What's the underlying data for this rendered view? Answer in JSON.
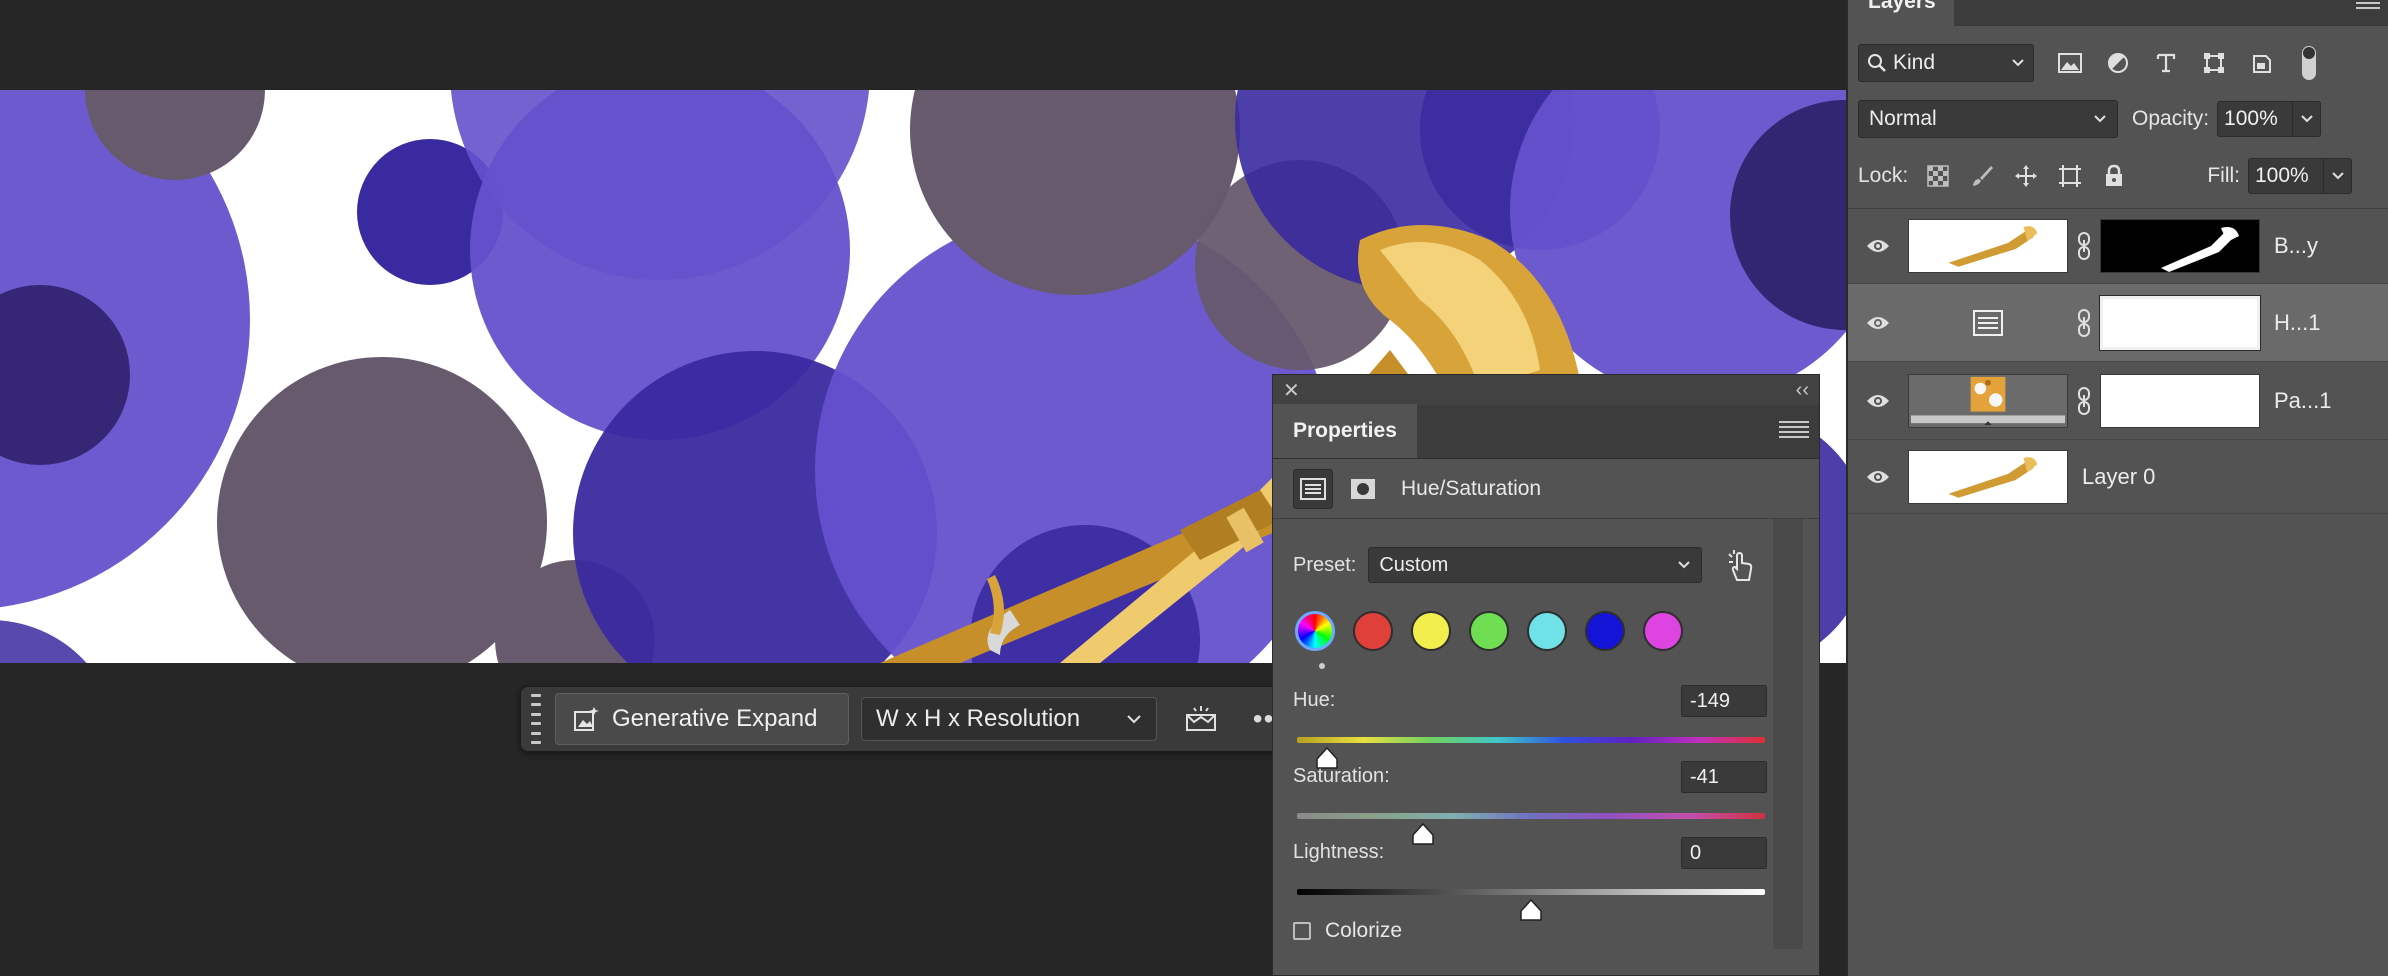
{
  "taskbar": {
    "generative_expand_label": "Generative Expand",
    "resolution_select_value": "W x H x Resolution",
    "more_label": "•••"
  },
  "properties": {
    "close_label": "✕",
    "collapse_label": "‹‹",
    "tab_label": "Properties",
    "adjustment_title": "Hue/Saturation",
    "preset_label": "Preset:",
    "preset_value": "Custom",
    "swatch_colors": [
      "#e0403a",
      "#f2ee4e",
      "#6fde52",
      "#6fe2e8",
      "#1414d8",
      "#dd44e2"
    ],
    "hue": {
      "label": "Hue:",
      "value": "-149"
    },
    "saturation": {
      "label": "Saturation:",
      "value": "-41"
    },
    "lightness": {
      "label": "Lightness:",
      "value": "0"
    },
    "colorize_label": "Colorize"
  },
  "layers": {
    "tab_label": "Layers",
    "kind_value": "Kind",
    "blend_mode": "Normal",
    "opacity_label": "Opacity:",
    "opacity_value": "100%",
    "lock_label": "Lock:",
    "fill_label": "Fill:",
    "fill_value": "100%",
    "items": [
      {
        "name": "B...y",
        "selected": false
      },
      {
        "name": "H...1",
        "selected": true
      },
      {
        "name": "Pa...1",
        "selected": false
      },
      {
        "name": "Layer 0",
        "selected": false
      }
    ]
  },
  "colors": {
    "accent_blue": "#6fa9ff",
    "canvas_purple": "#6551cc",
    "canvas_dark_purple": "#3a2aa0",
    "canvas_gray": "#675a6d"
  }
}
